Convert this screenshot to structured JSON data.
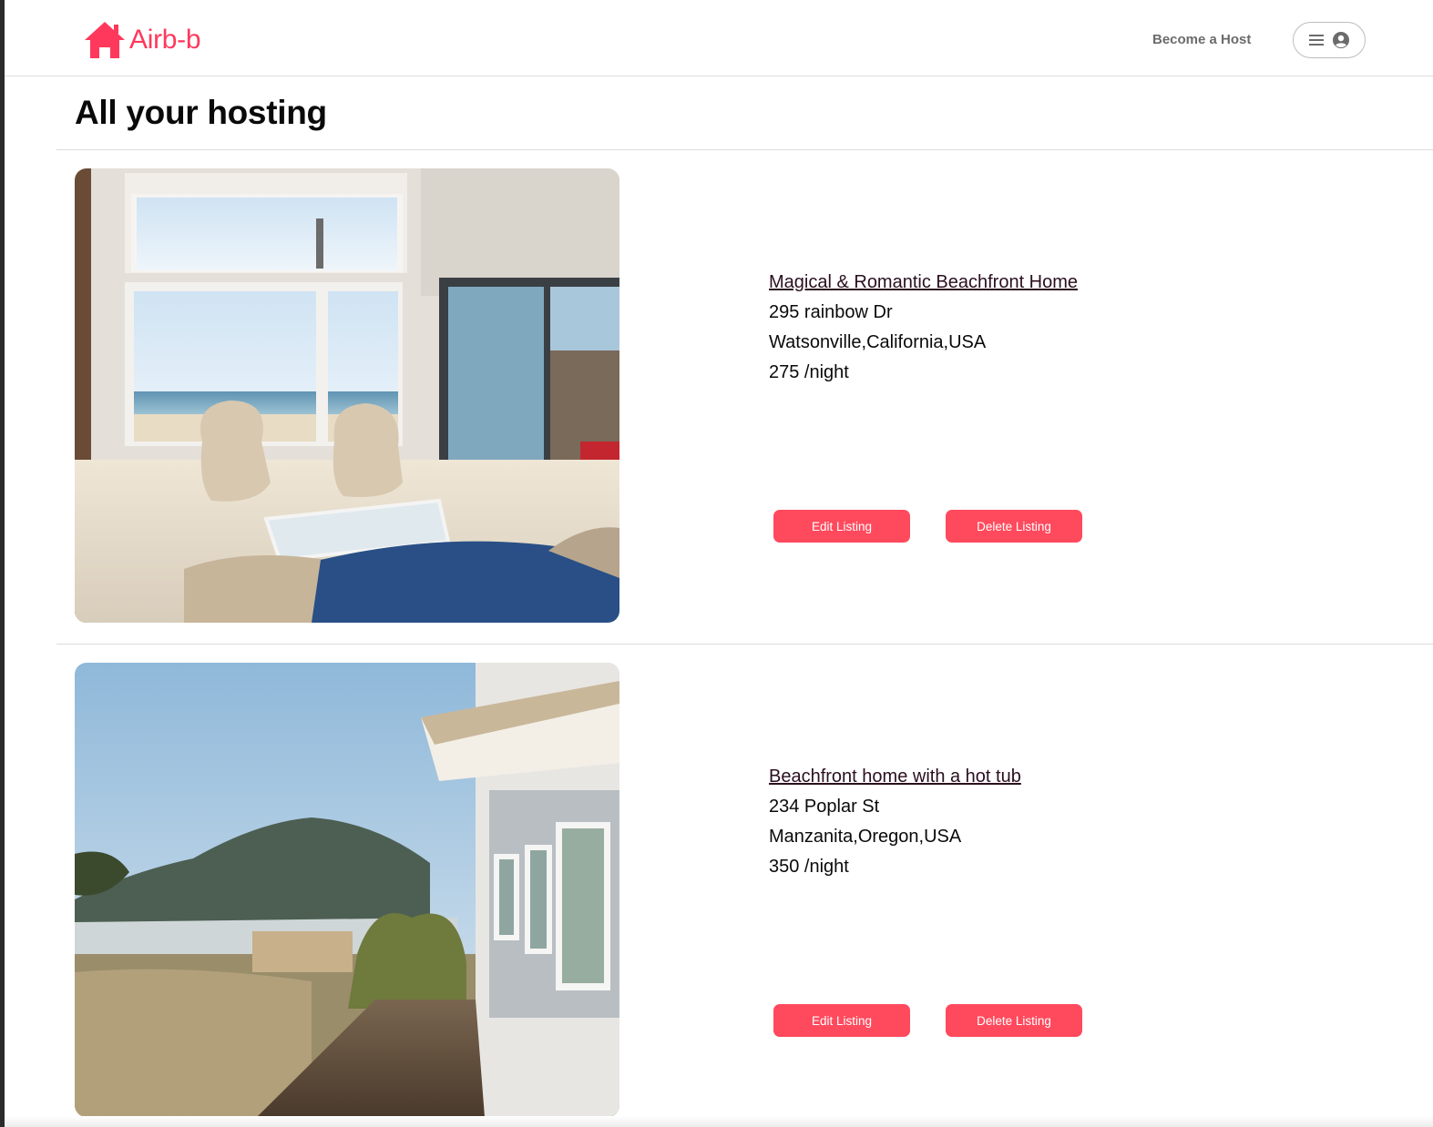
{
  "app": {
    "brand": "Airb-b",
    "brand_color": "#ff385c"
  },
  "header": {
    "logo_icon": "house-icon",
    "become_host_label": "Become a Host",
    "profile_menu": {
      "menu_icon": "hamburger-icon",
      "account_icon": "user-circle-icon"
    }
  },
  "page": {
    "title": "All your hosting"
  },
  "listings": [
    {
      "title": "Magical & Romantic Beachfront Home",
      "street": "295 rainbow Dr",
      "location": "Watsonville,California,USA",
      "price": "275 /night",
      "edit_label": "Edit Listing",
      "delete_label": "Delete Listing",
      "photo": "living-room-ocean-view-photo"
    },
    {
      "title": "Beachfront home with a hot tub",
      "street": "234 Poplar St",
      "location": "Manzanita,Oregon,USA",
      "price": "350 /night",
      "edit_label": "Edit Listing",
      "delete_label": "Delete Listing",
      "photo": "beach-house-boardwalk-photo"
    }
  ],
  "colors": {
    "button_bg": "#ff4a5d",
    "link_color": "#2a0f1e"
  }
}
